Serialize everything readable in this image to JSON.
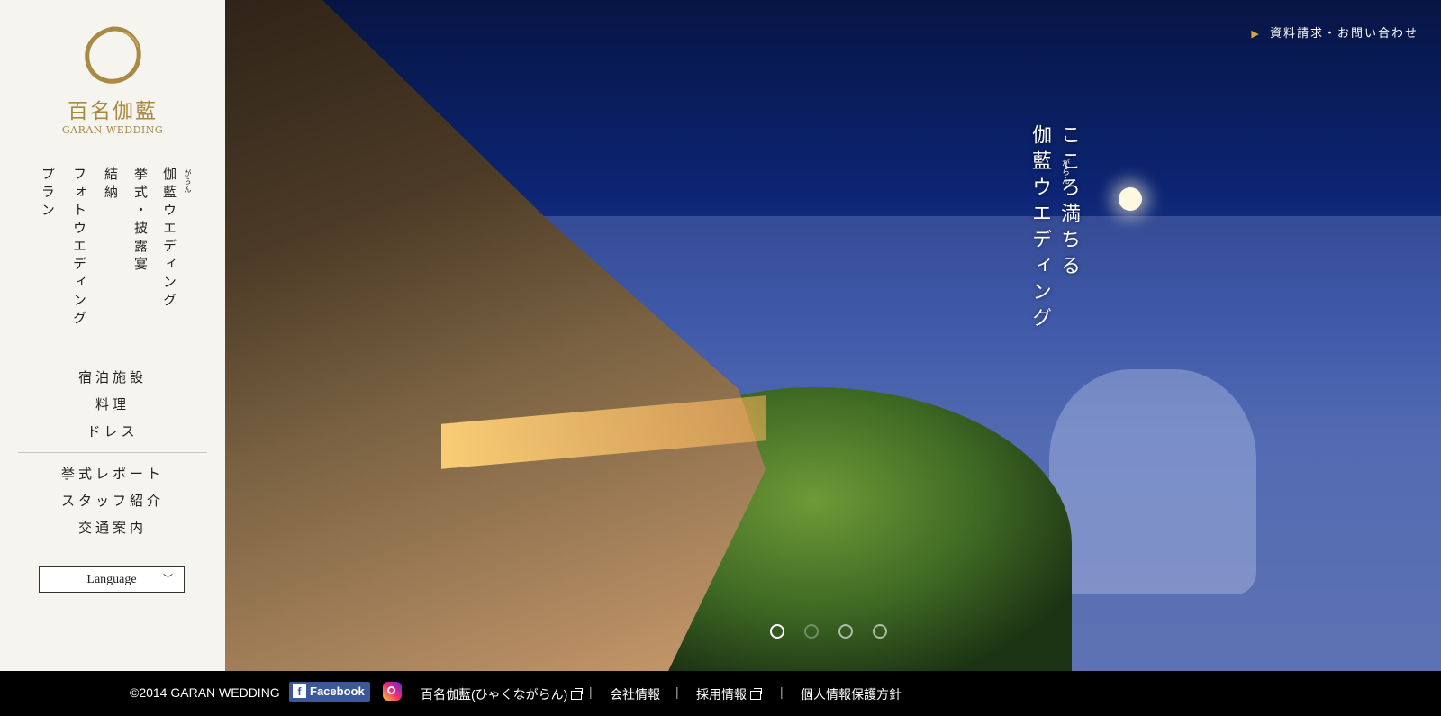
{
  "logo": {
    "jp": "百名伽藍",
    "en": "GARAN WEDDING"
  },
  "nav_vertical": [
    {
      "label": "伽藍ウエディング",
      "ruby": "がらん"
    },
    {
      "label": "挙式・披露宴"
    },
    {
      "label": "結納"
    },
    {
      "label": "フォトウエディング"
    },
    {
      "label": "プラン"
    }
  ],
  "nav_horizontal": [
    "宿泊施設",
    "料理",
    "ドレス",
    "挙式レポート",
    "スタッフ紹介",
    "交通案内"
  ],
  "language": "Language",
  "contact": "資料請求・お問い合わせ",
  "hero": {
    "line1": "こころ満ちる",
    "line2": "伽藍ウエディング",
    "ruby": "がらん"
  },
  "footer": {
    "copyright": "©2014 GARAN WEDDING",
    "facebook": "Facebook",
    "links": [
      "百名伽藍(ひゃくながらん)",
      "会社情報",
      "採用情報",
      "個人情報保護方針"
    ]
  },
  "carousel": {
    "count": 4,
    "active_index": 0
  },
  "colors": {
    "gold": "#a88a43",
    "sidebar_bg": "#f6f4ef",
    "footer_bg": "#000000",
    "facebook": "#3b5998"
  },
  "icons": [
    "ring-logo-icon",
    "chevron-down-icon",
    "triangle-icon",
    "facebook-icon",
    "instagram-icon",
    "external-link-icon"
  ]
}
